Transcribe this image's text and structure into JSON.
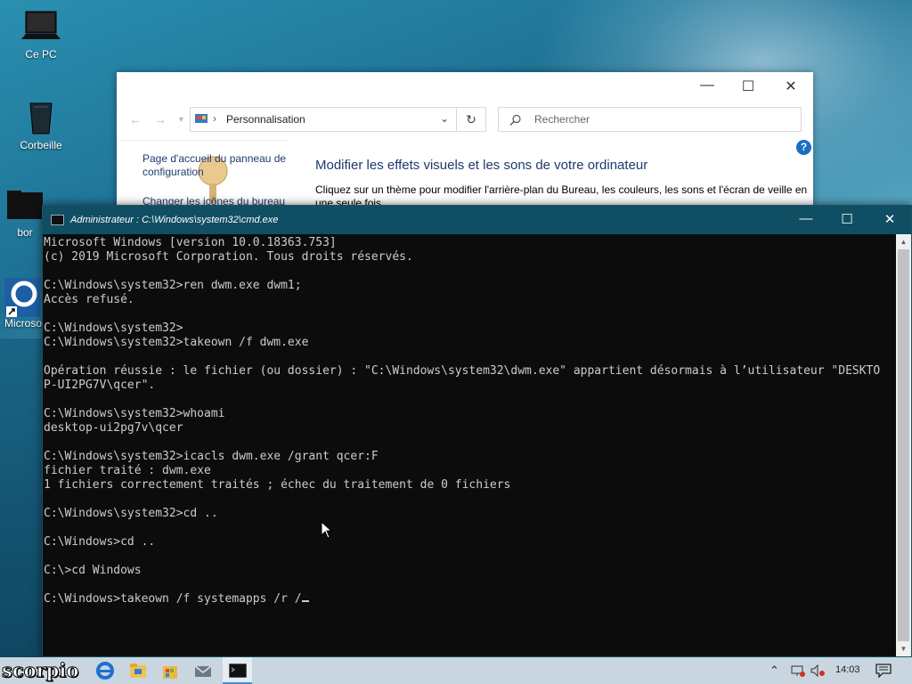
{
  "desktop": {
    "icons": [
      {
        "label": "Ce PC",
        "icon": "laptop-icon"
      },
      {
        "label": "Corbeille",
        "icon": "recycle-bin-icon"
      },
      {
        "label": "bor",
        "icon": "folder-icon"
      },
      {
        "label": "Microso",
        "icon": "edge-shortcut-icon"
      }
    ]
  },
  "explorer": {
    "address": "Personnalisation",
    "search_placeholder": "Rechercher",
    "help_glyph": "?",
    "left_links": [
      "Page d'accueil du panneau de configuration",
      "Changer les icônes du bureau"
    ],
    "heading": "Modifier les effets visuels et les sons de votre ordinateur",
    "description": "Cliquez sur un thème pour modifier l'arrière-plan du Bureau, les couleurs, les sons et l'écran de veille en une seule fois."
  },
  "cmd": {
    "title": "Administrateur : C:\\Windows\\system32\\cmd.exe",
    "lines": [
      "Microsoft Windows [version 10.0.18363.753]",
      "(c) 2019 Microsoft Corporation. Tous droits réservés.",
      "",
      "C:\\Windows\\system32>ren dwm.exe dwm1;",
      "Accès refusé.",
      "",
      "C:\\Windows\\system32>",
      "C:\\Windows\\system32>takeown /f dwm.exe",
      "",
      "Opération réussie : le fichier (ou dossier) : \"C:\\Windows\\system32\\dwm.exe\" appartient désormais à l’utilisateur \"DESKTO",
      "P-UI2PG7V\\qcer\".",
      "",
      "C:\\Windows\\system32>whoami",
      "desktop-ui2pg7v\\qcer",
      "",
      "C:\\Windows\\system32>icacls dwm.exe /grant qcer:F",
      "fichier traité : dwm.exe",
      "1 fichiers correctement traités ; échec du traitement de 0 fichiers",
      "",
      "C:\\Windows\\system32>cd ..",
      "",
      "C:\\Windows>cd ..",
      "",
      "C:\\>cd Windows",
      "",
      "C:\\Windows>takeown /f systemapps /r /"
    ]
  },
  "taskbar": {
    "logo": "scorpio",
    "clock": "14:03"
  },
  "colors": {
    "cmd_titlebar": "#0f4e63",
    "cmd_bg": "#0c0c0c",
    "cmd_text": "#cccccc",
    "taskbar": "#c9d6e0",
    "link": "#1e3a6e"
  }
}
